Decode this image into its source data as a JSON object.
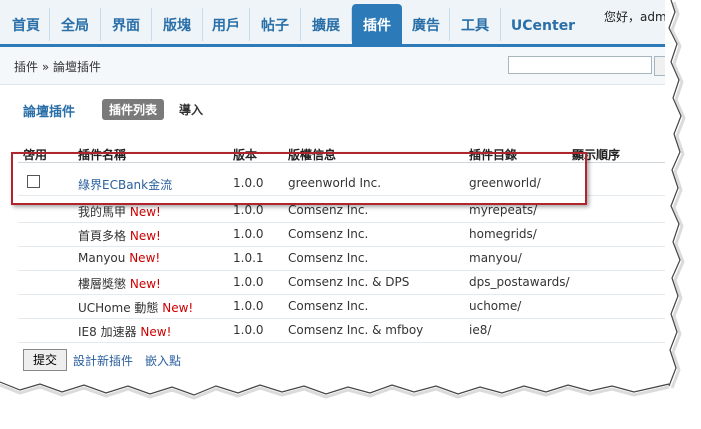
{
  "nav": {
    "tabs": [
      "首頁",
      "全局",
      "界面",
      "版塊",
      "用戶",
      "帖子",
      "擴展",
      "插件",
      "廣告",
      "工具",
      "UCenter"
    ],
    "active": "插件",
    "greeting": "您好，admi"
  },
  "breadcrumb": {
    "root": "插件",
    "sep": "»",
    "current": "論壇插件"
  },
  "section": {
    "title": "論壇插件",
    "tab_list": "插件列表",
    "tab_import": "導入"
  },
  "table": {
    "headers": {
      "enable": "啓用",
      "name": "插件名稱",
      "version": "版本",
      "copyright": "版權信息",
      "dir": "插件目錄",
      "order": "顯示順序"
    },
    "rows": [
      {
        "name": "綠界ECBank金流",
        "new": "",
        "version": "1.0.0",
        "copyright": "greenworld Inc.",
        "dir": "greenworld/"
      },
      {
        "name": "我的馬甲",
        "new": "New!",
        "version": "1.0.0",
        "copyright": "Comsenz Inc.",
        "dir": "myrepeats/"
      },
      {
        "name": "首頁多格",
        "new": "New!",
        "version": "1.0.0",
        "copyright": "Comsenz Inc.",
        "dir": "homegrids/"
      },
      {
        "name": "Manyou",
        "new": "New!",
        "version": "1.0.1",
        "copyright": "Comsenz Inc.",
        "dir": "manyou/"
      },
      {
        "name": "樓層獎懲",
        "new": "New!",
        "version": "1.0.0",
        "copyright": "Comsenz Inc. & DPS",
        "dir": "dps_postawards/"
      },
      {
        "name": "UCHome 動態",
        "new": "New!",
        "version": "1.0.0",
        "copyright": "Comsenz Inc.",
        "dir": "uchome/"
      },
      {
        "name": "IE8 加速器",
        "new": "New!",
        "version": "1.0.0",
        "copyright": "Comsenz Inc. & mfboy",
        "dir": "ie8/"
      }
    ]
  },
  "actions": {
    "submit": "提交",
    "design": "設計新插件",
    "hooks": "嵌入點"
  },
  "search": {
    "value": ""
  },
  "colors": {
    "accent": "#2c7ab8",
    "highlight": "#b0242e",
    "new": "#cc0000"
  }
}
